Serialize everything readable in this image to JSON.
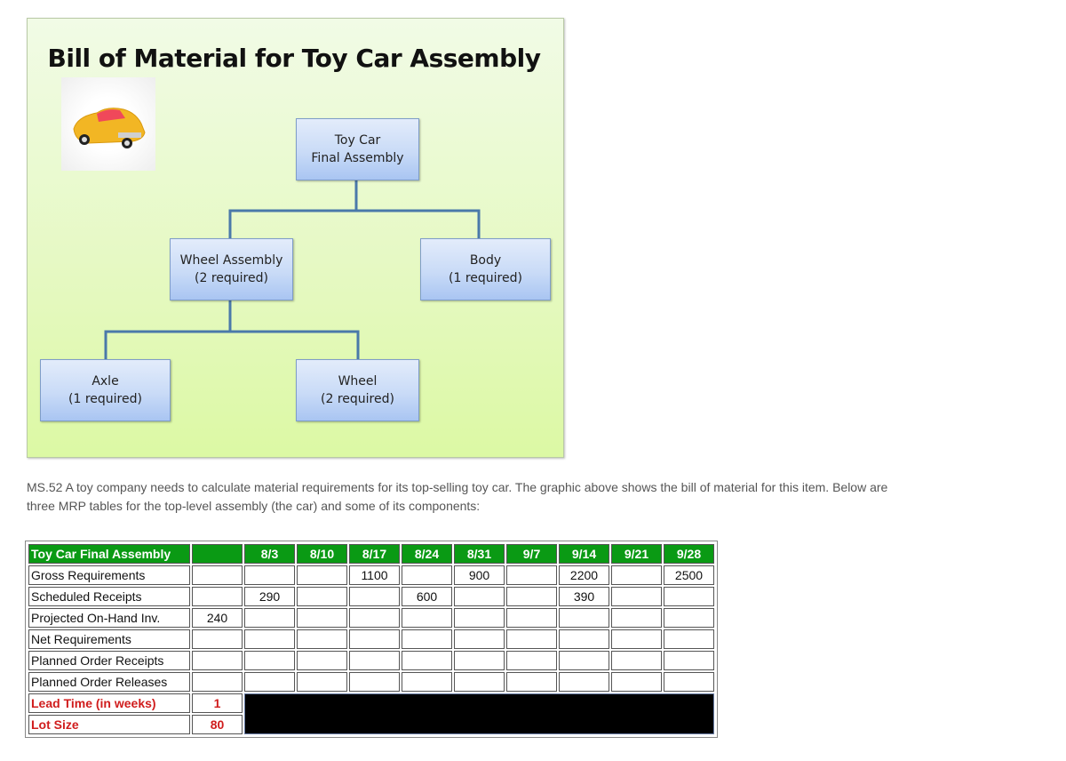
{
  "diagram": {
    "title": "Bill of Material for Toy Car Assembly",
    "image_alt": "yellow toy car photo",
    "nodes": {
      "car": {
        "line1": "Toy Car",
        "line2": "Final Assembly"
      },
      "wheel_asm": {
        "line1": "Wheel Assembly",
        "line2": "(2 required)"
      },
      "body": {
        "line1": "Body",
        "line2": "(1 required)"
      },
      "axle": {
        "line1": "Axle",
        "line2": "(1 required)"
      },
      "wheel": {
        "line1": "Wheel",
        "line2": "(2 required)"
      }
    },
    "colors": {
      "panel": "#e6f9c4",
      "node": "#c9dbf7",
      "connector": "#4a79aa"
    }
  },
  "problem": {
    "text": "MS.52 A toy company needs to calculate material requirements for its top-selling toy car. The graphic above shows the bill of material for this item. Below are three MRP tables for the top-level assembly (the car) and some of its components:"
  },
  "mrp_table": {
    "title": "Toy Car Final Assembly",
    "weeks": [
      "8/3",
      "8/10",
      "8/17",
      "8/24",
      "8/31",
      "9/7",
      "9/14",
      "9/21",
      "9/28"
    ],
    "rows": [
      {
        "label": "Gross Requirements",
        "initial": "",
        "values": [
          "",
          "",
          "1100",
          "",
          "900",
          "",
          "2200",
          "",
          "2500"
        ]
      },
      {
        "label": "Scheduled Receipts",
        "initial": "",
        "values": [
          "290",
          "",
          "",
          "600",
          "",
          "",
          "390",
          "",
          ""
        ]
      },
      {
        "label": "Projected On-Hand Inv.",
        "initial": "240",
        "values": [
          "",
          "",
          "",
          "",
          "",
          "",
          "",
          "",
          ""
        ]
      },
      {
        "label": "Net Requirements",
        "initial": "",
        "values": [
          "",
          "",
          "",
          "",
          "",
          "",
          "",
          "",
          ""
        ]
      },
      {
        "label": "Planned Order Receipts",
        "initial": "",
        "values": [
          "",
          "",
          "",
          "",
          "",
          "",
          "",
          "",
          ""
        ]
      },
      {
        "label": "Planned Order Releases",
        "initial": "",
        "values": [
          "",
          "",
          "",
          "",
          "",
          "",
          "",
          "",
          ""
        ]
      }
    ],
    "lead_time": {
      "label": "Lead Time (in weeks)",
      "value": "1"
    },
    "lot_size": {
      "label": "Lot Size",
      "value": "80"
    },
    "colors": {
      "header": "#0a9a14",
      "param_text": "#d01d1d"
    }
  }
}
